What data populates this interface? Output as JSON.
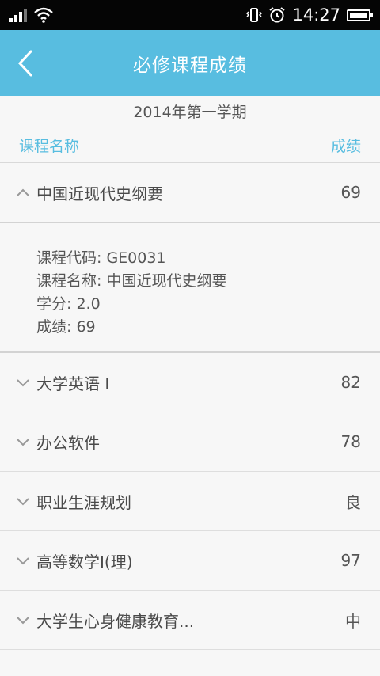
{
  "status": {
    "time": "14:27"
  },
  "header": {
    "title": "必修课程成绩"
  },
  "term": "2014年第一学期",
  "columns": {
    "name": "课程名称",
    "score": "成绩"
  },
  "expanded_course": {
    "name": "中国近现代史纲要",
    "score": "69",
    "details": [
      "课程代码: GE0031",
      "课程名称: 中国近现代史纲要",
      "学分: 2.0",
      "成绩: 69"
    ]
  },
  "courses": [
    {
      "name": "大学英语 I",
      "score": "82"
    },
    {
      "name": "办公软件",
      "score": "78"
    },
    {
      "name": "职业生涯规划",
      "score": "良"
    },
    {
      "name": "高等数学I(理)",
      "score": "97"
    },
    {
      "name": "大学生心身健康教育...",
      "score": "中"
    }
  ],
  "colors": {
    "accent": "#58bde0",
    "status_bar": "#050505",
    "background": "#f7f7f7"
  }
}
